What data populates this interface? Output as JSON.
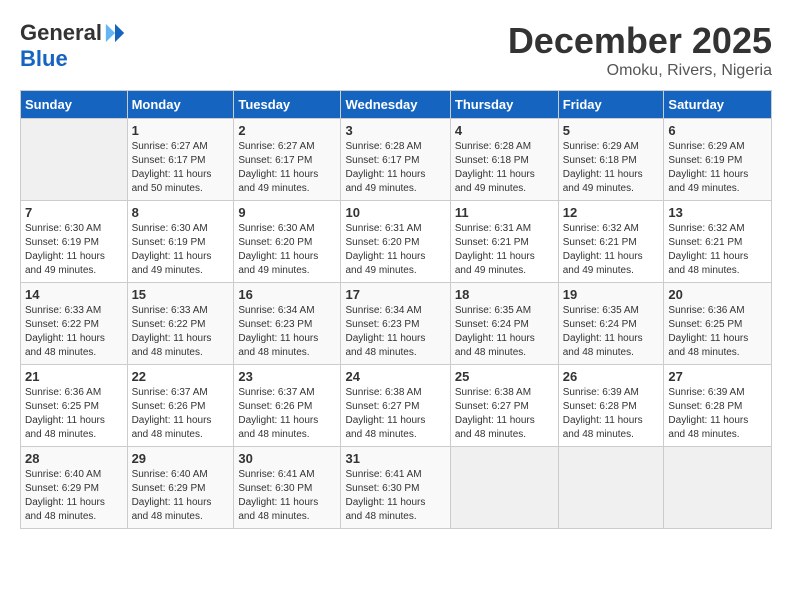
{
  "header": {
    "logo_general": "General",
    "logo_blue": "Blue",
    "month_title": "December 2025",
    "location": "Omoku, Rivers, Nigeria"
  },
  "calendar": {
    "days_of_week": [
      "Sunday",
      "Monday",
      "Tuesday",
      "Wednesday",
      "Thursday",
      "Friday",
      "Saturday"
    ],
    "weeks": [
      [
        {
          "day": "",
          "info": ""
        },
        {
          "day": "1",
          "info": "Sunrise: 6:27 AM\nSunset: 6:17 PM\nDaylight: 11 hours\nand 50 minutes."
        },
        {
          "day": "2",
          "info": "Sunrise: 6:27 AM\nSunset: 6:17 PM\nDaylight: 11 hours\nand 49 minutes."
        },
        {
          "day": "3",
          "info": "Sunrise: 6:28 AM\nSunset: 6:17 PM\nDaylight: 11 hours\nand 49 minutes."
        },
        {
          "day": "4",
          "info": "Sunrise: 6:28 AM\nSunset: 6:18 PM\nDaylight: 11 hours\nand 49 minutes."
        },
        {
          "day": "5",
          "info": "Sunrise: 6:29 AM\nSunset: 6:18 PM\nDaylight: 11 hours\nand 49 minutes."
        },
        {
          "day": "6",
          "info": "Sunrise: 6:29 AM\nSunset: 6:19 PM\nDaylight: 11 hours\nand 49 minutes."
        }
      ],
      [
        {
          "day": "7",
          "info": "Sunrise: 6:30 AM\nSunset: 6:19 PM\nDaylight: 11 hours\nand 49 minutes."
        },
        {
          "day": "8",
          "info": "Sunrise: 6:30 AM\nSunset: 6:19 PM\nDaylight: 11 hours\nand 49 minutes."
        },
        {
          "day": "9",
          "info": "Sunrise: 6:30 AM\nSunset: 6:20 PM\nDaylight: 11 hours\nand 49 minutes."
        },
        {
          "day": "10",
          "info": "Sunrise: 6:31 AM\nSunset: 6:20 PM\nDaylight: 11 hours\nand 49 minutes."
        },
        {
          "day": "11",
          "info": "Sunrise: 6:31 AM\nSunset: 6:21 PM\nDaylight: 11 hours\nand 49 minutes."
        },
        {
          "day": "12",
          "info": "Sunrise: 6:32 AM\nSunset: 6:21 PM\nDaylight: 11 hours\nand 49 minutes."
        },
        {
          "day": "13",
          "info": "Sunrise: 6:32 AM\nSunset: 6:21 PM\nDaylight: 11 hours\nand 48 minutes."
        }
      ],
      [
        {
          "day": "14",
          "info": "Sunrise: 6:33 AM\nSunset: 6:22 PM\nDaylight: 11 hours\nand 48 minutes."
        },
        {
          "day": "15",
          "info": "Sunrise: 6:33 AM\nSunset: 6:22 PM\nDaylight: 11 hours\nand 48 minutes."
        },
        {
          "day": "16",
          "info": "Sunrise: 6:34 AM\nSunset: 6:23 PM\nDaylight: 11 hours\nand 48 minutes."
        },
        {
          "day": "17",
          "info": "Sunrise: 6:34 AM\nSunset: 6:23 PM\nDaylight: 11 hours\nand 48 minutes."
        },
        {
          "day": "18",
          "info": "Sunrise: 6:35 AM\nSunset: 6:24 PM\nDaylight: 11 hours\nand 48 minutes."
        },
        {
          "day": "19",
          "info": "Sunrise: 6:35 AM\nSunset: 6:24 PM\nDaylight: 11 hours\nand 48 minutes."
        },
        {
          "day": "20",
          "info": "Sunrise: 6:36 AM\nSunset: 6:25 PM\nDaylight: 11 hours\nand 48 minutes."
        }
      ],
      [
        {
          "day": "21",
          "info": "Sunrise: 6:36 AM\nSunset: 6:25 PM\nDaylight: 11 hours\nand 48 minutes."
        },
        {
          "day": "22",
          "info": "Sunrise: 6:37 AM\nSunset: 6:26 PM\nDaylight: 11 hours\nand 48 minutes."
        },
        {
          "day": "23",
          "info": "Sunrise: 6:37 AM\nSunset: 6:26 PM\nDaylight: 11 hours\nand 48 minutes."
        },
        {
          "day": "24",
          "info": "Sunrise: 6:38 AM\nSunset: 6:27 PM\nDaylight: 11 hours\nand 48 minutes."
        },
        {
          "day": "25",
          "info": "Sunrise: 6:38 AM\nSunset: 6:27 PM\nDaylight: 11 hours\nand 48 minutes."
        },
        {
          "day": "26",
          "info": "Sunrise: 6:39 AM\nSunset: 6:28 PM\nDaylight: 11 hours\nand 48 minutes."
        },
        {
          "day": "27",
          "info": "Sunrise: 6:39 AM\nSunset: 6:28 PM\nDaylight: 11 hours\nand 48 minutes."
        }
      ],
      [
        {
          "day": "28",
          "info": "Sunrise: 6:40 AM\nSunset: 6:29 PM\nDaylight: 11 hours\nand 48 minutes."
        },
        {
          "day": "29",
          "info": "Sunrise: 6:40 AM\nSunset: 6:29 PM\nDaylight: 11 hours\nand 48 minutes."
        },
        {
          "day": "30",
          "info": "Sunrise: 6:41 AM\nSunset: 6:30 PM\nDaylight: 11 hours\nand 48 minutes."
        },
        {
          "day": "31",
          "info": "Sunrise: 6:41 AM\nSunset: 6:30 PM\nDaylight: 11 hours\nand 48 minutes."
        },
        {
          "day": "",
          "info": ""
        },
        {
          "day": "",
          "info": ""
        },
        {
          "day": "",
          "info": ""
        }
      ]
    ]
  }
}
